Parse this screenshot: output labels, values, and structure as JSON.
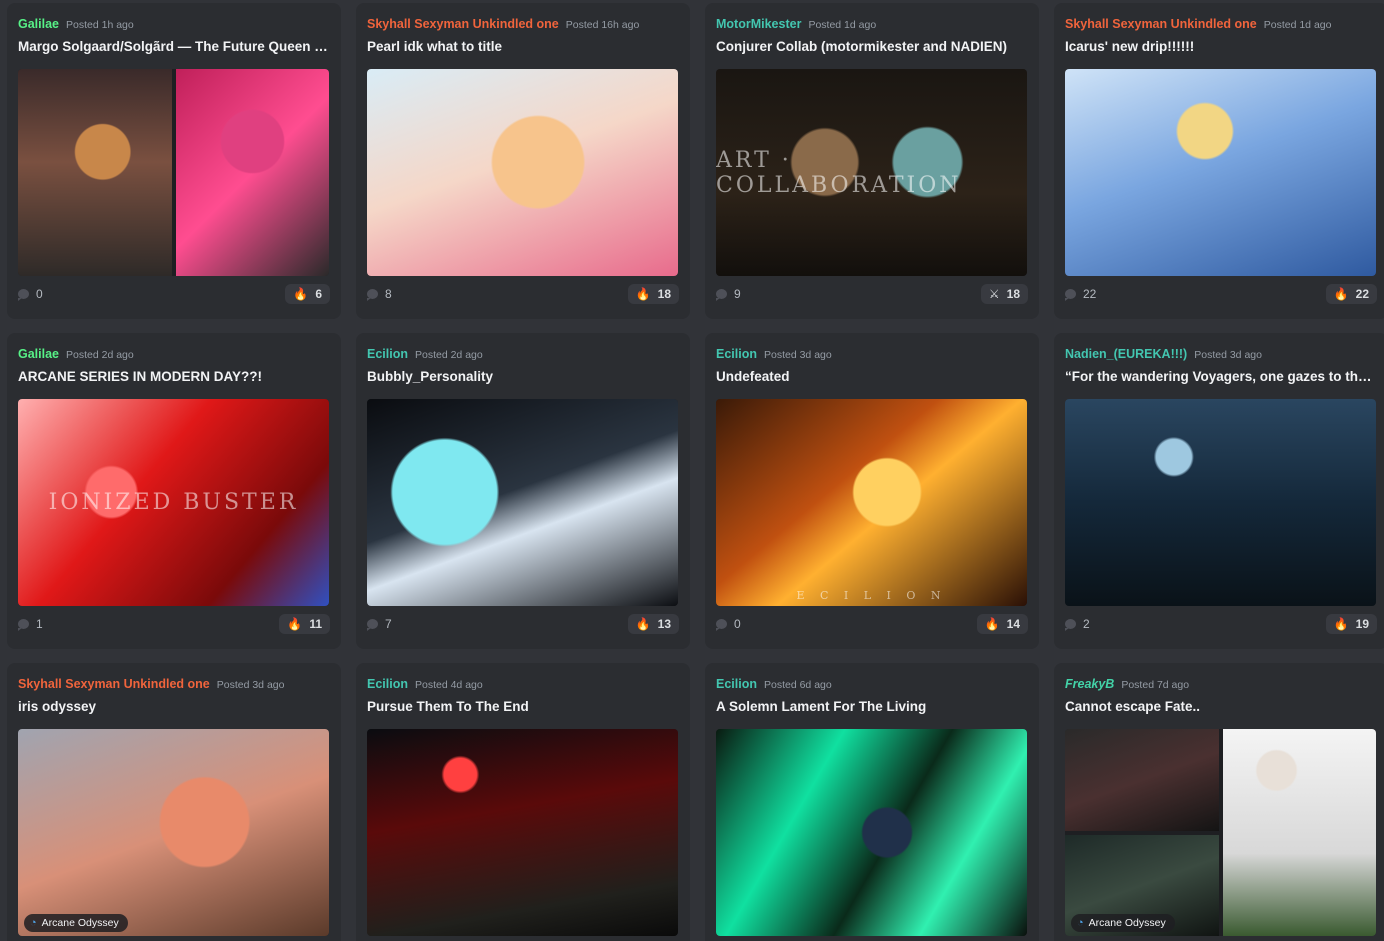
{
  "colors": {
    "author_green": "#57f287",
    "author_orange": "#f0643c",
    "author_teal": "#43c6b0",
    "author_freaky": "#43d3a8"
  },
  "posts": [
    {
      "author": "Galilae",
      "author_color": "#57f287",
      "posted": "Posted 1h ago",
      "title": "Margo Solgaard/Solgãrd — The Future Queen …",
      "comments": "0",
      "reaction_emoji": "🔥",
      "reaction_count": "6"
    },
    {
      "author": "Skyhall Sexyman Unkindled one",
      "author_color": "#f0643c",
      "posted": "Posted 16h ago",
      "title": "Pearl idk what to title",
      "comments": "8",
      "reaction_emoji": "🔥",
      "reaction_count": "18"
    },
    {
      "author": "MotorMikester",
      "author_color": "#43c6b0",
      "posted": "Posted 1d ago",
      "title": "Conjurer Collab (motormikester and NADIEN)",
      "comments": "9",
      "reaction_emoji": "⚔",
      "reaction_count": "18",
      "art_text": "ART · COLLABORATION"
    },
    {
      "author": "Skyhall Sexyman Unkindled one",
      "author_color": "#f0643c",
      "posted": "Posted 1d ago",
      "title": "Icarus' new drip!!!!!!",
      "comments": "22",
      "reaction_emoji": "🔥",
      "reaction_count": "22"
    },
    {
      "author": "Galilae",
      "author_color": "#57f287",
      "posted": "Posted 2d ago",
      "title": "ARCANE SERIES IN MODERN DAY??!",
      "comments": "1",
      "reaction_emoji": "🔥",
      "reaction_count": "11",
      "art_text": "IONIZED BUSTER"
    },
    {
      "author": "Ecilion",
      "author_color": "#43c6b0",
      "posted": "Posted 2d ago",
      "title": "Bubbly_Personality",
      "comments": "7",
      "reaction_emoji": "🔥",
      "reaction_count": "13"
    },
    {
      "author": "Ecilion",
      "author_color": "#43c6b0",
      "posted": "Posted 3d ago",
      "title": "Undefeated",
      "comments": "0",
      "reaction_emoji": "🔥",
      "reaction_count": "14",
      "art_text": "E C I L I O N"
    },
    {
      "author": "Nadien_(EUREKA!!!)",
      "author_color": "#43c6b0",
      "posted": "Posted 3d ago",
      "title": "“For the wandering Voyagers, one gazes to the …",
      "comments": "2",
      "reaction_emoji": "🔥",
      "reaction_count": "19"
    },
    {
      "author": "Skyhall Sexyman Unkindled one",
      "author_color": "#f0643c",
      "posted": "Posted 3d ago",
      "title": "iris odyssey",
      "tag": "Arcane Odyssey"
    },
    {
      "author": "Ecilion",
      "author_color": "#43c6b0",
      "posted": "Posted 4d ago",
      "title": "Pursue Them To The End"
    },
    {
      "author": "Ecilion",
      "author_color": "#43c6b0",
      "posted": "Posted 6d ago",
      "title": "A Solemn Lament For The Living"
    },
    {
      "author": "FreakyB",
      "author_color": "#43d3a8",
      "posted": "Posted 7d ago",
      "title": "Cannot escape Fate..",
      "tag": "Arcane Odyssey"
    }
  ]
}
